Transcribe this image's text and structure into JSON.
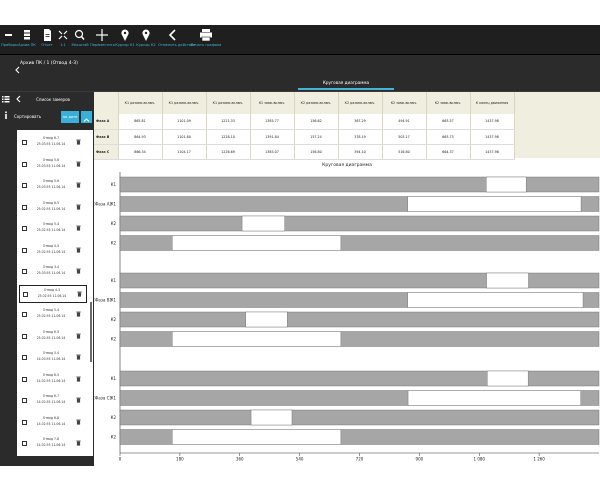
{
  "toolbar": {
    "items": [
      {
        "label": "Приборы",
        "icon": "minus-icon"
      },
      {
        "label": "Архив ПК",
        "icon": "database-icon"
      },
      {
        "label": "Отчет",
        "icon": "document-icon"
      },
      {
        "label": "1:1",
        "icon": "shrink-icon"
      },
      {
        "label": "Масштаб",
        "icon": "magnifier-icon"
      },
      {
        "label": "Переместить",
        "icon": "move-arrows-icon"
      },
      {
        "label": "Курсор К1",
        "icon": "map-pin-icon"
      },
      {
        "label": "Курсор К2",
        "icon": "map-pin-icon"
      },
      {
        "label": "Отменить действие",
        "icon": "chevron-left-icon"
      },
      {
        "label": "Печать графика",
        "icon": "printer-icon"
      }
    ]
  },
  "breadcrumb": {
    "text": "Архив ПК / 1 (Отвод 4-3)"
  },
  "tabs": {
    "active": "Круговая диаграмма"
  },
  "left_panel": {
    "title": "Список замеров",
    "sort_label": "Сортировать",
    "sort_button": "по дате",
    "items": [
      {
        "name": "Отвод 6-7",
        "date": "25.03.93 11.06.14",
        "selected": false
      },
      {
        "name": "Отвод 5-6",
        "date": "25.03.93 11.06.14",
        "selected": false
      },
      {
        "name": "Отвод 5-6",
        "date": "25.03.93 11.06.14",
        "selected": false
      },
      {
        "name": "Отвод 6-5",
        "date": "25.02.93 11.06.14",
        "selected": false
      },
      {
        "name": "Отвод 5-4",
        "date": "25.02.93 11.06.14",
        "selected": false
      },
      {
        "name": "Отвод 4-5",
        "date": "25.02.93 11.06.14",
        "selected": false
      },
      {
        "name": "Отвод 3-4",
        "date": "25.03.93 11.06.14",
        "selected": false
      },
      {
        "name": "Отвод 4-3",
        "date": "25.02.93 11.06.14",
        "selected": true
      },
      {
        "name": "Отвод 5-4",
        "date": "25.02.93 11.06.14",
        "selected": false
      },
      {
        "name": "Отвод 6-5",
        "date": "25.02.93 11.06.14",
        "selected": false
      },
      {
        "name": "Отвод 5-4",
        "date": "14.03.93 11.06.14",
        "selected": false
      },
      {
        "name": "Отвод 6-5",
        "date": "14.02.93 11.06.14",
        "selected": false
      },
      {
        "name": "Отвод 6-7",
        "date": "14.02.93 11.06.14",
        "selected": false
      },
      {
        "name": "Отвод 6-8",
        "date": "14.02.93 11.06.14",
        "selected": false
      },
      {
        "name": "Отвод 7-8",
        "date": "14.02.93 11.06.14",
        "selected": false
      }
    ]
  },
  "table": {
    "headers": [
      "К1 разомк.включ.",
      "К1 разомк.включ.",
      "К1 разомк.включ.",
      "К1 замк.включ.",
      "К2 разомк.включ.",
      "К2 разомк.включ.",
      "К2 замк.включ.",
      "К2 замк.включ.",
      "К конец движения"
    ],
    "rows": [
      {
        "label": "Фаза А",
        "values": [
          "865.81",
          "1101.09",
          "1221.33",
          "1385.77",
          "156.62",
          "367.29",
          "494.91",
          "663.57",
          "1437.98"
        ]
      },
      {
        "label": "Фаза В",
        "values": [
          "864.93",
          "1101.80",
          "1228.10",
          "1391.84",
          "157.24",
          "378.19",
          "503.17",
          "663.75",
          "1437.98"
        ]
      },
      {
        "label": "Фаза С",
        "values": [
          "866.34",
          "1104.17",
          "1226.69",
          "1385.07",
          "156.80",
          "394.10",
          "516.80",
          "664.37",
          "1437.98"
        ]
      }
    ]
  },
  "chart_data": {
    "type": "bar",
    "title": "Круговая диаграмма",
    "xlim": [
      0,
      1440
    ],
    "xticks": [
      0,
      180,
      360,
      540,
      720,
      900,
      1080,
      1260
    ],
    "xticklabels": [
      "0",
      "180",
      "360",
      "540",
      "720",
      "900",
      "1 080",
      "1 260"
    ],
    "groups": [
      {
        "name": "[Фаза А]",
        "rows": [
          {
            "label": "К1",
            "white": [
              1101,
              1221
            ]
          },
          {
            "label": "К1",
            "white": [
              865,
              1386
            ]
          },
          {
            "label": "К2",
            "white": [
              367,
              495
            ]
          },
          {
            "label": "К2",
            "white": [
              157,
              664
            ]
          }
        ]
      },
      {
        "name": "[Фаза В]",
        "rows": [
          {
            "label": "К1",
            "white": [
              1102,
              1228
            ]
          },
          {
            "label": "К1",
            "white": [
              865,
              1392
            ]
          },
          {
            "label": "К2",
            "white": [
              378,
              503
            ]
          },
          {
            "label": "К2",
            "white": [
              157,
              664
            ]
          }
        ]
      },
      {
        "name": "[Фаза С]",
        "rows": [
          {
            "label": "К1",
            "white": [
              1104,
              1227
            ]
          },
          {
            "label": "К1",
            "white": [
              866,
              1385
            ]
          },
          {
            "label": "К2",
            "white": [
              394,
              517
            ]
          },
          {
            "label": "К2",
            "white": [
              157,
              664
            ]
          }
        ]
      }
    ],
    "colors": {
      "bar": "#a6a6a6",
      "gap": "#ffffff"
    }
  }
}
